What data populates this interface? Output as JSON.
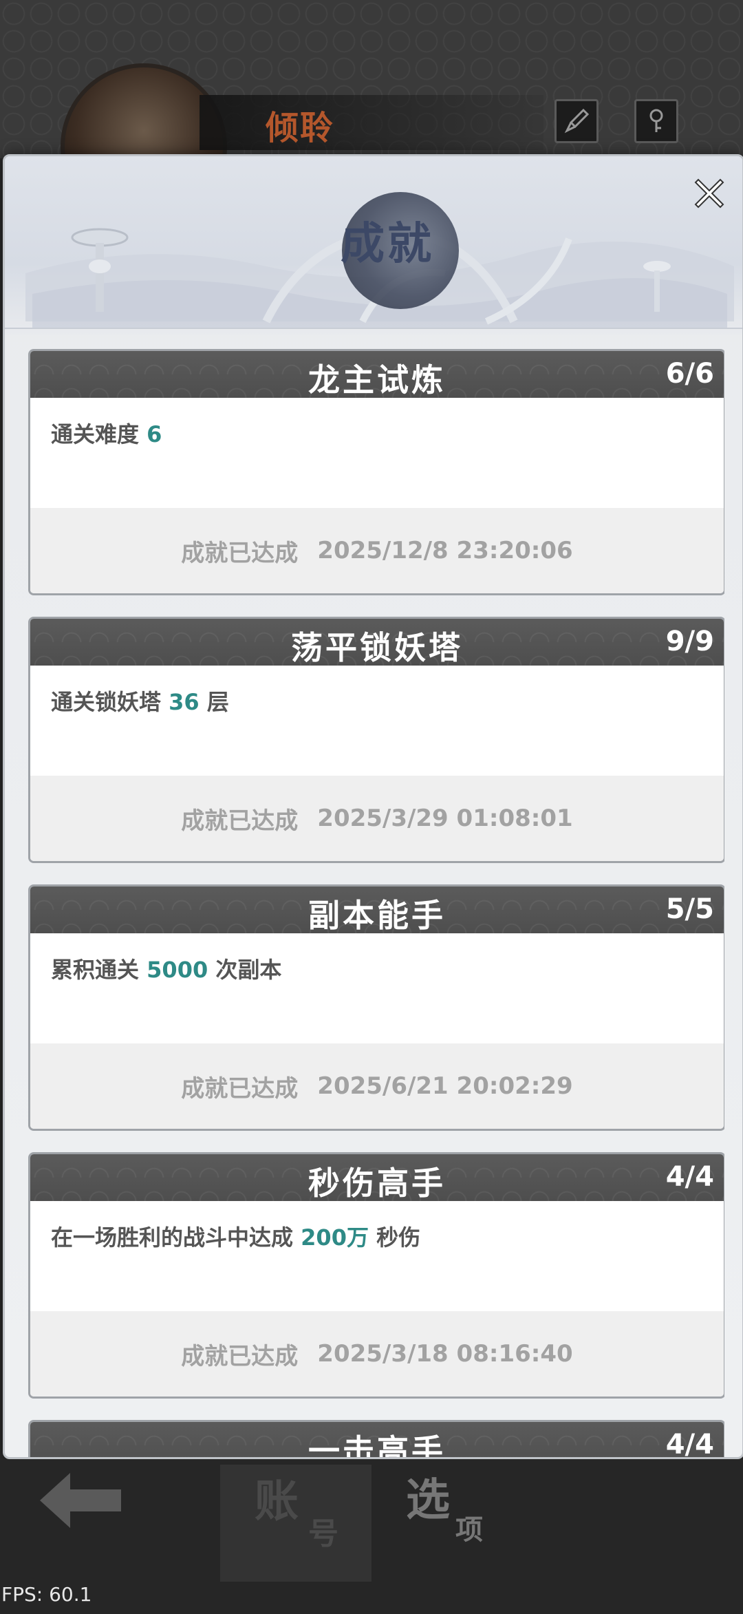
{
  "player": {
    "name": "倾聆"
  },
  "modal": {
    "title": "成就",
    "achievements": [
      {
        "title": "龙主试炼",
        "progress": "6/6",
        "desc_before": "通关难度 ",
        "desc_highlight": "6",
        "desc_after": "",
        "status": "成就已达成",
        "timestamp": "2025/12/8 23:20:06"
      },
      {
        "title": "荡平锁妖塔",
        "progress": "9/9",
        "desc_before": "通关锁妖塔 ",
        "desc_highlight": "36",
        "desc_after": " 层",
        "status": "成就已达成",
        "timestamp": "2025/3/29 01:08:01"
      },
      {
        "title": "副本能手",
        "progress": "5/5",
        "desc_before": "累积通关 ",
        "desc_highlight": "5000",
        "desc_after": " 次副本",
        "status": "成就已达成",
        "timestamp": "2025/6/21 20:02:29"
      },
      {
        "title": "秒伤高手",
        "progress": "4/4",
        "desc_before": "在一场胜利的战斗中达成 ",
        "desc_highlight": "200万",
        "desc_after": " 秒伤",
        "status": "成就已达成",
        "timestamp": "2025/3/18 08:16:40"
      },
      {
        "title": "一击高手",
        "progress": "4/4",
        "desc_before": "",
        "desc_highlight": "",
        "desc_after": "",
        "status": "",
        "timestamp": ""
      }
    ]
  },
  "bottom_nav": {
    "account_big": "账",
    "account_small": "号",
    "options_big": "选",
    "options_small": "项"
  },
  "fps": "FPS: 60.1",
  "colors": {
    "highlight": "#2e8a86",
    "name": "#b4572c",
    "title": "#3c4866"
  }
}
